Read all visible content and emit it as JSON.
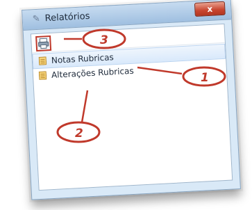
{
  "window": {
    "title": "Relatórios",
    "close_glyph": "x"
  },
  "toolbar": {
    "print_icon": "printer-icon"
  },
  "tree": {
    "items": [
      {
        "label": "Notas Rubricas",
        "icon": "document-icon",
        "selected": true
      },
      {
        "label": "Alterações Rubricas",
        "icon": "document-icon",
        "selected": false
      }
    ]
  },
  "annotations": {
    "callouts": [
      "1",
      "2",
      "3"
    ],
    "color": "#c0392b"
  }
}
